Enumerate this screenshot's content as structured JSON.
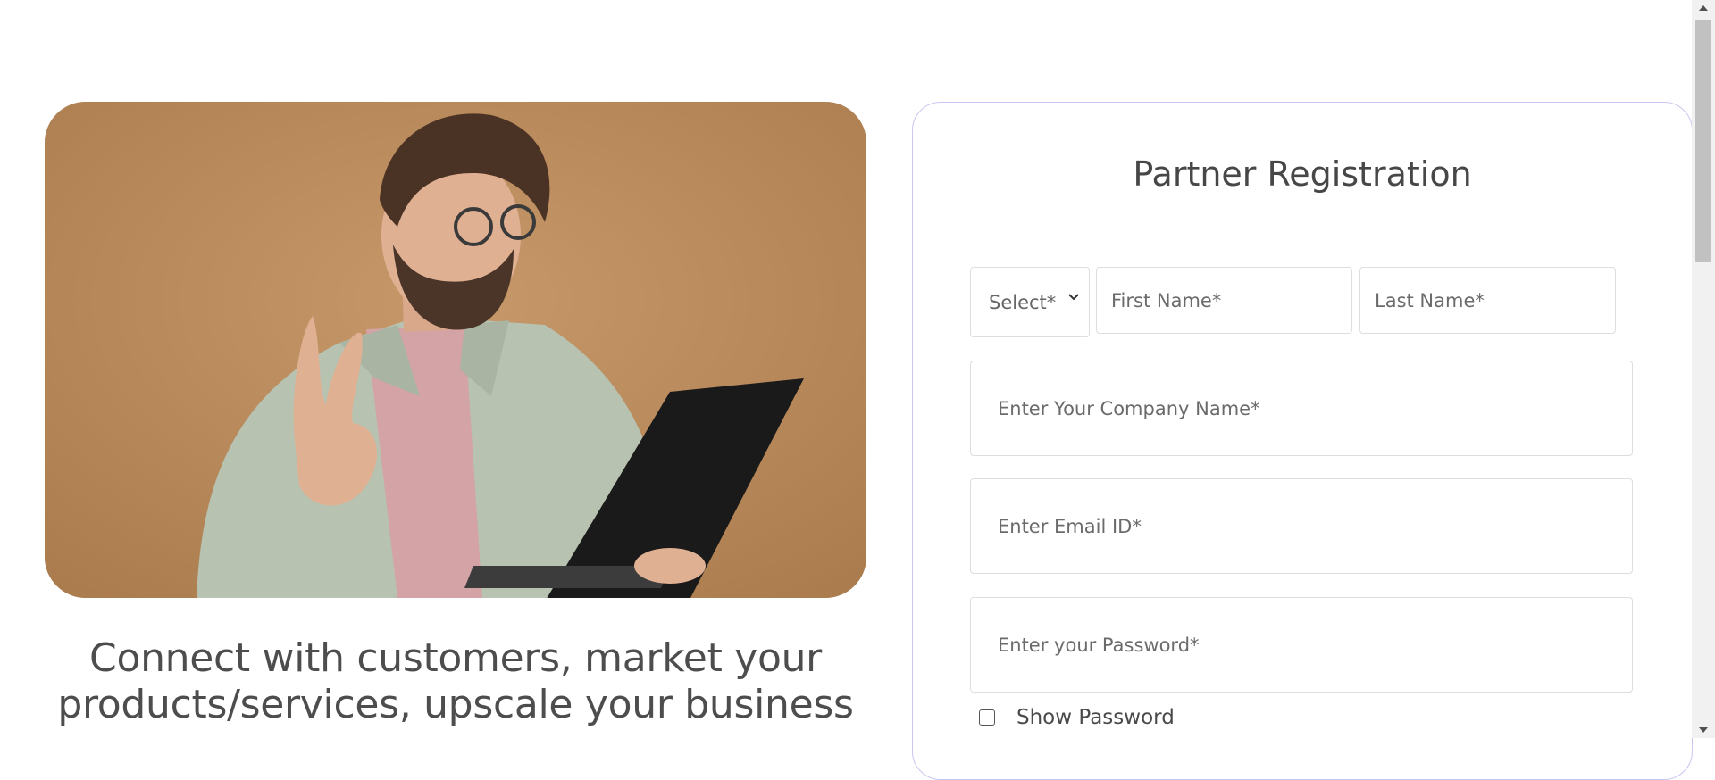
{
  "hero": {
    "image_icon": "man-with-laptop-photo",
    "tagline_line1": "Connect with customers, market your",
    "tagline_line2": "products/services, upscale your business"
  },
  "form": {
    "title": "Partner Registration",
    "title_select": {
      "selected": "Select*"
    },
    "first_name_placeholder": "First Name*",
    "last_name_placeholder": "Last Name*",
    "company_placeholder": "Enter Your Company Name*",
    "email_placeholder": "Enter Email ID*",
    "password_placeholder": "Enter your Password*",
    "show_password_label": "Show Password",
    "show_password_checked": false
  },
  "colors": {
    "hero_background": "#b98a5b",
    "card_border": "#c9c6ef",
    "text_dark": "#4d4d4d"
  }
}
